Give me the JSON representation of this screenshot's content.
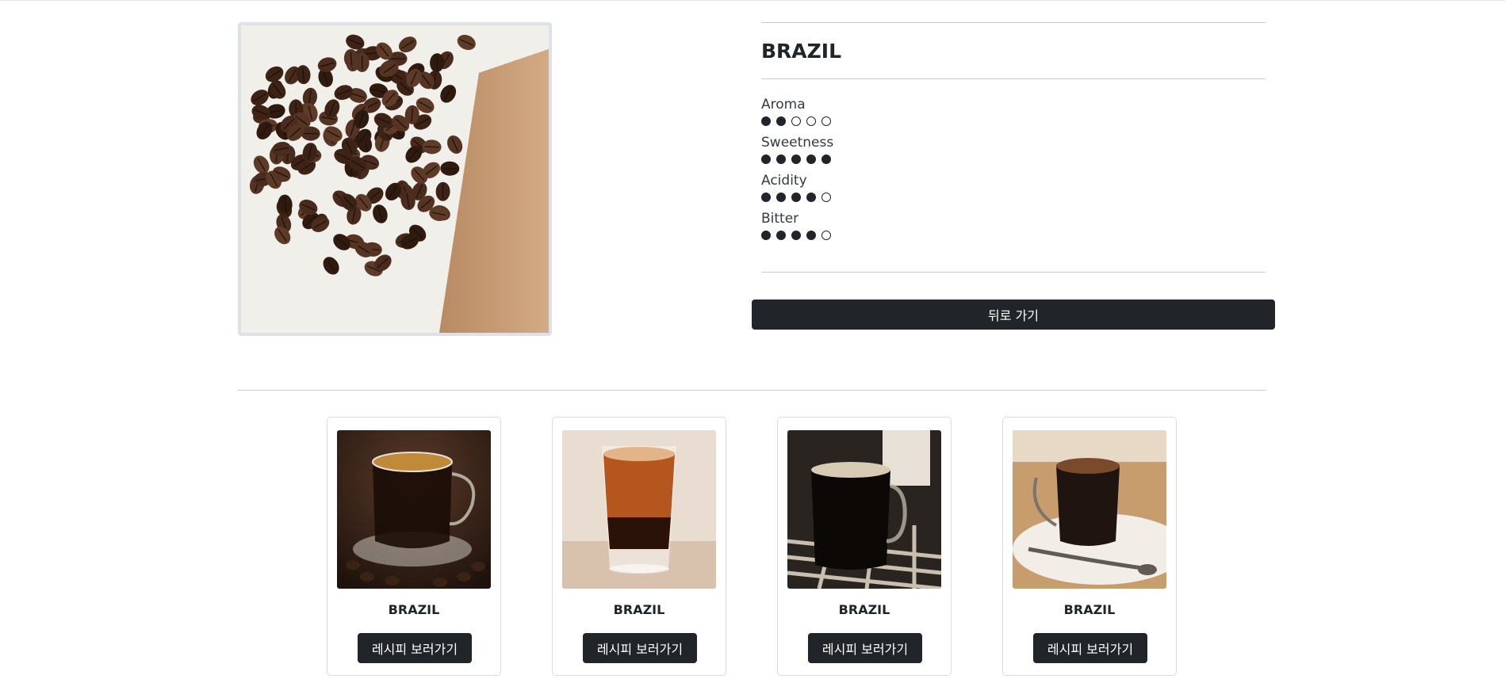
{
  "product": {
    "name": "BRAZIL",
    "image": "coffee-beans-photo"
  },
  "attributes": [
    {
      "label": "Aroma",
      "score": 2,
      "max": 5
    },
    {
      "label": "Sweetness",
      "score": 5,
      "max": 5
    },
    {
      "label": "Acidity",
      "score": 4,
      "max": 5
    },
    {
      "label": "Bitter",
      "score": 4,
      "max": 5
    }
  ],
  "actions": {
    "back_label": "뒤로 가기"
  },
  "recipes": [
    {
      "name": "BRAZIL",
      "button_label": "레시피 보러가기",
      "image": "espresso-cup-on-saucer-photo"
    },
    {
      "name": "BRAZIL",
      "button_label": "레시피 보러가기",
      "image": "layered-shot-glass-photo"
    },
    {
      "name": "BRAZIL",
      "button_label": "레시피 보러가기",
      "image": "glass-mug-coffee-photo"
    },
    {
      "name": "BRAZIL",
      "button_label": "레시피 보러가기",
      "image": "espresso-with-spoon-photo"
    }
  ],
  "colors": {
    "dark": "#212529",
    "rule": "#c9c9c9"
  }
}
